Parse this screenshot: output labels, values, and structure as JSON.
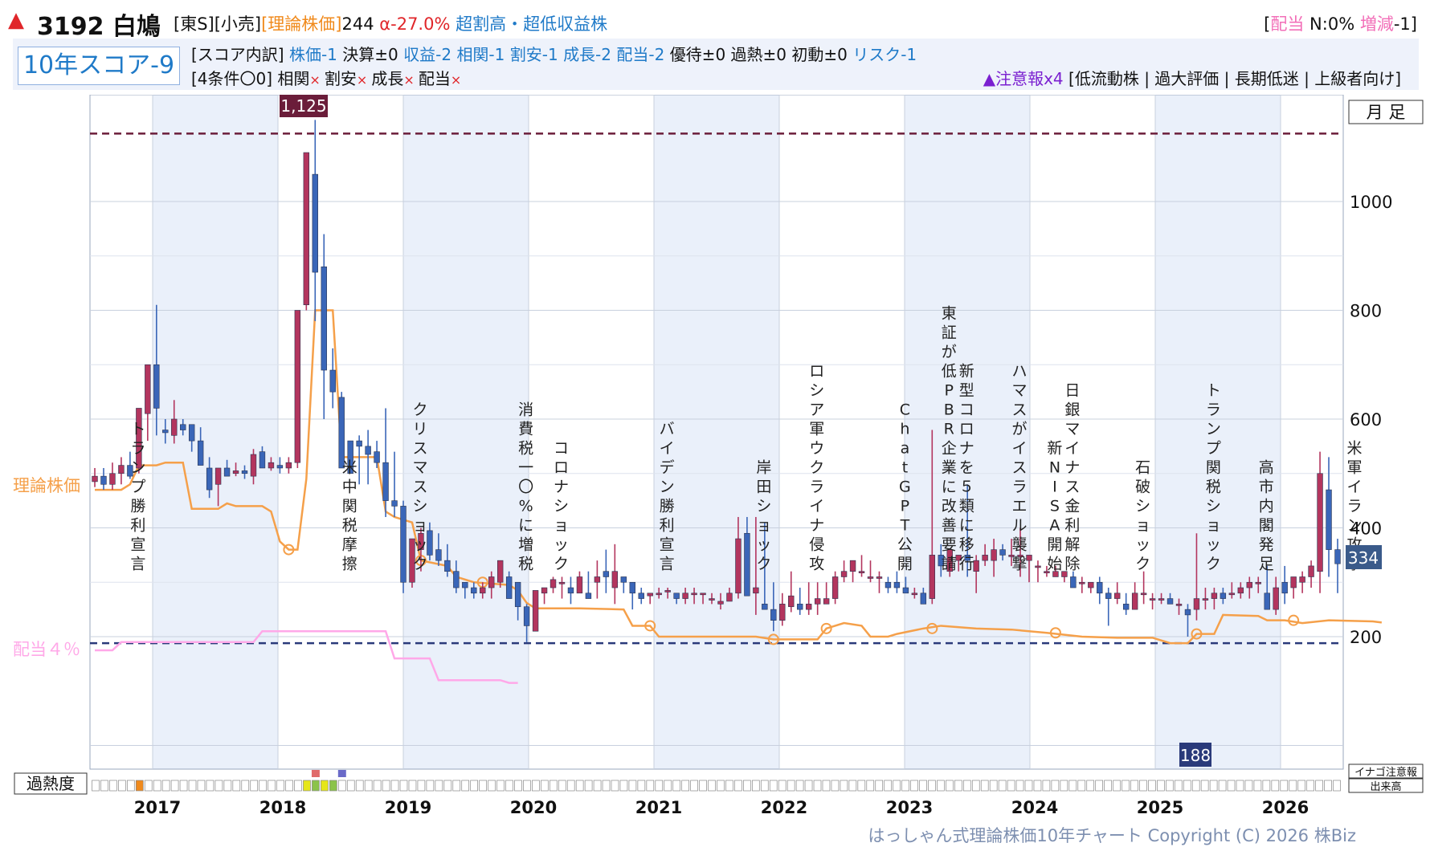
{
  "header": {
    "code": "3192",
    "name": "白鳩",
    "market": "[東S]",
    "industry": "[小売]",
    "theory_label": "[理論株価]",
    "theory_value": "244",
    "alpha": "α-27.0%",
    "tags": "超割高・超低収益株",
    "dividend_label": "配当",
    "dividend_n": "N:0%",
    "dividend_change_label": "増減",
    "dividend_change": "-1"
  },
  "score": {
    "box": "10年スコア-9",
    "breakdown_label": "[スコア内訳]",
    "items": [
      {
        "text": "株価-1",
        "color": "#1f7ac8"
      },
      {
        "text": "決算±0",
        "color": "#111111"
      },
      {
        "text": "収益-2",
        "color": "#1f7ac8"
      },
      {
        "text": "相関-1",
        "color": "#1f7ac8"
      },
      {
        "text": "割安-1",
        "color": "#1f7ac8"
      },
      {
        "text": "成長-2",
        "color": "#1f7ac8"
      },
      {
        "text": "配当-2",
        "color": "#1f7ac8"
      },
      {
        "text": "優待±0",
        "color": "#111111"
      },
      {
        "text": "過熱±0",
        "color": "#111111"
      },
      {
        "text": "初動±0",
        "color": "#111111"
      },
      {
        "text": "リスク-1",
        "color": "#1f7ac8"
      }
    ],
    "conditions_label": "[4条件〇0]",
    "conditions": [
      "相関",
      "割安",
      "成長",
      "配当"
    ],
    "cross": "×",
    "warning_label": "▲注意報x4",
    "warning_items": "[低流動株 | 過大評価 | 長期低迷 | 上級者向け]"
  },
  "chart_data": {
    "type": "candlestick",
    "period_label": "月 足",
    "y_ticks": [
      200,
      400,
      600,
      800,
      1000
    ],
    "ylim": [
      0,
      1200
    ],
    "x_labels": [
      "2017",
      "2018",
      "2019",
      "2020",
      "2021",
      "2022",
      "2023",
      "2024",
      "2025",
      "2026"
    ],
    "max_label": "1,125",
    "min_label": "188",
    "last_label": "334",
    "high_line": 1125,
    "low_line": 188,
    "theory_label": "理論株価",
    "dividend_label": "配当４％",
    "candles": [
      [
        485,
        510,
        475,
        495
      ],
      [
        495,
        510,
        470,
        480
      ],
      [
        480,
        520,
        470,
        500
      ],
      [
        500,
        530,
        480,
        515
      ],
      [
        515,
        540,
        490,
        495
      ],
      [
        510,
        620,
        500,
        620
      ],
      [
        610,
        700,
        560,
        700
      ],
      [
        700,
        810,
        570,
        620
      ],
      [
        580,
        600,
        555,
        575
      ],
      [
        570,
        635,
        555,
        600
      ],
      [
        590,
        600,
        570,
        580
      ],
      [
        590,
        590,
        540,
        560
      ],
      [
        560,
        585,
        520,
        515
      ],
      [
        510,
        530,
        455,
        470
      ],
      [
        480,
        510,
        440,
        510
      ],
      [
        510,
        525,
        495,
        495
      ],
      [
        500,
        520,
        495,
        505
      ],
      [
        505,
        515,
        490,
        500
      ],
      [
        495,
        545,
        480,
        535
      ],
      [
        540,
        550,
        510,
        510
      ],
      [
        510,
        530,
        505,
        520
      ],
      [
        515,
        530,
        500,
        510
      ],
      [
        510,
        530,
        500,
        520
      ],
      [
        520,
        800,
        510,
        800
      ],
      [
        810,
        1090,
        800,
        1090
      ],
      [
        1050,
        1150,
        780,
        870
      ],
      [
        880,
        940,
        600,
        690
      ],
      [
        690,
        730,
        620,
        650
      ],
      [
        640,
        650,
        520,
        510
      ],
      [
        560,
        560,
        520,
        500
      ],
      [
        560,
        570,
        480,
        550
      ],
      [
        550,
        580,
        480,
        535
      ],
      [
        540,
        560,
        510,
        520
      ],
      [
        520,
        620,
        420,
        450
      ],
      [
        450,
        540,
        420,
        440
      ],
      [
        440,
        450,
        280,
        300
      ],
      [
        300,
        380,
        290,
        380
      ],
      [
        360,
        400,
        320,
        390
      ],
      [
        395,
        410,
        340,
        350
      ],
      [
        360,
        390,
        330,
        340
      ],
      [
        340,
        370,
        310,
        320
      ],
      [
        320,
        340,
        280,
        290
      ],
      [
        300,
        300,
        270,
        290
      ],
      [
        290,
        300,
        270,
        280
      ],
      [
        280,
        300,
        270,
        290
      ],
      [
        290,
        320,
        270,
        310
      ],
      [
        300,
        340,
        290,
        340
      ],
      [
        310,
        320,
        270,
        270
      ],
      [
        300,
        300,
        230,
        255
      ],
      [
        255,
        260,
        190,
        220
      ],
      [
        210,
        280,
        210,
        285
      ],
      [
        280,
        290,
        260,
        290
      ],
      [
        290,
        310,
        280,
        305
      ],
      [
        300,
        310,
        270,
        300
      ],
      [
        290,
        310,
        260,
        280
      ],
      [
        280,
        320,
        280,
        310
      ],
      [
        280,
        320,
        270,
        270
      ],
      [
        300,
        340,
        270,
        310
      ],
      [
        320,
        360,
        280,
        310
      ],
      [
        290,
        370,
        260,
        320
      ],
      [
        310,
        310,
        280,
        300
      ],
      [
        300,
        300,
        250,
        280
      ],
      [
        280,
        290,
        260,
        270
      ],
      [
        275,
        280,
        260,
        280
      ],
      [
        280,
        290,
        270,
        280
      ],
      [
        285,
        290,
        270,
        285
      ],
      [
        280,
        280,
        260,
        270
      ],
      [
        270,
        290,
        260,
        280
      ],
      [
        280,
        290,
        260,
        280
      ],
      [
        280,
        280,
        260,
        280
      ],
      [
        270,
        280,
        260,
        270
      ],
      [
        260,
        280,
        250,
        265
      ],
      [
        265,
        290,
        270,
        280
      ],
      [
        280,
        420,
        270,
        380
      ],
      [
        390,
        420,
        300,
        275
      ],
      [
        280,
        420,
        240,
        290
      ],
      [
        260,
        410,
        250,
        250
      ],
      [
        250,
        300,
        210,
        230
      ],
      [
        230,
        280,
        220,
        260
      ],
      [
        255,
        320,
        245,
        275
      ],
      [
        260,
        290,
        240,
        250
      ],
      [
        250,
        300,
        240,
        260
      ],
      [
        260,
        300,
        240,
        270
      ],
      [
        260,
        300,
        260,
        270
      ],
      [
        270,
        320,
        260,
        310
      ],
      [
        310,
        340,
        300,
        320
      ],
      [
        320,
        340,
        300,
        340
      ],
      [
        320,
        350,
        310,
        320
      ],
      [
        310,
        340,
        300,
        310
      ],
      [
        310,
        320,
        280,
        310
      ],
      [
        300,
        310,
        280,
        290
      ],
      [
        300,
        320,
        280,
        290
      ],
      [
        290,
        310,
        280,
        280
      ],
      [
        280,
        290,
        270,
        280
      ],
      [
        280,
        290,
        260,
        260
      ],
      [
        270,
        580,
        260,
        350
      ],
      [
        350,
        370,
        310,
        330
      ],
      [
        320,
        360,
        310,
        360
      ],
      [
        340,
        350,
        320,
        350
      ],
      [
        350,
        480,
        310,
        340
      ],
      [
        320,
        350,
        280,
        340
      ],
      [
        340,
        370,
        330,
        350
      ],
      [
        340,
        380,
        310,
        360
      ],
      [
        360,
        370,
        340,
        350
      ],
      [
        350,
        380,
        330,
        350
      ],
      [
        350,
        400,
        310,
        350
      ],
      [
        340,
        340,
        300,
        350
      ],
      [
        330,
        340,
        300,
        330
      ],
      [
        320,
        330,
        310,
        320
      ],
      [
        310,
        330,
        310,
        320
      ],
      [
        310,
        320,
        300,
        320
      ],
      [
        310,
        320,
        290,
        290
      ],
      [
        300,
        310,
        280,
        300
      ],
      [
        290,
        300,
        280,
        300
      ],
      [
        300,
        310,
        260,
        280
      ],
      [
        280,
        290,
        220,
        270
      ],
      [
        270,
        300,
        260,
        280
      ],
      [
        260,
        280,
        240,
        250
      ],
      [
        250,
        300,
        250,
        280
      ],
      [
        280,
        320,
        260,
        280
      ],
      [
        270,
        280,
        250,
        270
      ],
      [
        270,
        280,
        260,
        270
      ],
      [
        270,
        280,
        260,
        260
      ],
      [
        260,
        270,
        240,
        260
      ],
      [
        250,
        260,
        200,
        240
      ],
      [
        250,
        390,
        230,
        270
      ],
      [
        270,
        290,
        250,
        270
      ],
      [
        270,
        290,
        250,
        280
      ],
      [
        280,
        290,
        260,
        270
      ],
      [
        280,
        300,
        270,
        280
      ],
      [
        280,
        300,
        270,
        290
      ],
      [
        290,
        310,
        270,
        300
      ],
      [
        300,
        310,
        280,
        300
      ],
      [
        280,
        330,
        250,
        250
      ],
      [
        250,
        310,
        240,
        290
      ],
      [
        300,
        330,
        260,
        280
      ],
      [
        290,
        310,
        270,
        310
      ],
      [
        300,
        320,
        280,
        310
      ],
      [
        310,
        340,
        290,
        330
      ],
      [
        320,
        540,
        280,
        500
      ],
      [
        470,
        530,
        310,
        360
      ],
      [
        360,
        380,
        280,
        334
      ]
    ],
    "theory": [
      [
        0,
        470
      ],
      [
        3,
        470
      ],
      [
        4,
        480
      ],
      [
        5,
        515
      ],
      [
        7,
        515
      ],
      [
        8,
        520
      ],
      [
        10,
        520
      ],
      [
        11,
        435
      ],
      [
        14,
        435
      ],
      [
        15,
        445
      ],
      [
        16,
        440
      ],
      [
        18,
        440
      ],
      [
        19,
        440
      ],
      [
        20,
        430
      ],
      [
        21,
        375
      ],
      [
        22,
        360
      ],
      [
        23,
        360
      ],
      [
        24,
        490
      ],
      [
        25,
        800
      ],
      [
        27,
        800
      ],
      [
        28,
        530
      ],
      [
        32,
        530
      ],
      [
        33,
        430
      ],
      [
        34,
        420
      ],
      [
        36,
        410
      ],
      [
        37,
        340
      ],
      [
        40,
        330
      ],
      [
        41,
        310
      ],
      [
        43,
        300
      ],
      [
        47,
        295
      ],
      [
        48,
        285
      ],
      [
        49,
        262
      ],
      [
        50,
        252
      ],
      [
        55,
        252
      ],
      [
        60,
        250
      ],
      [
        61,
        220
      ],
      [
        63,
        220
      ],
      [
        64,
        200
      ],
      [
        66,
        200
      ],
      [
        72,
        200
      ],
      [
        75,
        200
      ],
      [
        77,
        195
      ],
      [
        82,
        195
      ],
      [
        83,
        215
      ],
      [
        85,
        225
      ],
      [
        87,
        220
      ],
      [
        88,
        200
      ],
      [
        90,
        200
      ],
      [
        91,
        205
      ],
      [
        94,
        215
      ],
      [
        96,
        220
      ],
      [
        100,
        215
      ],
      [
        104,
        213
      ],
      [
        108,
        207
      ],
      [
        112,
        200
      ],
      [
        116,
        198
      ],
      [
        120,
        198
      ],
      [
        122,
        188
      ],
      [
        124,
        188
      ],
      [
        125,
        205
      ],
      [
        127,
        205
      ],
      [
        128,
        240
      ],
      [
        132,
        238
      ],
      [
        133,
        230
      ],
      [
        135,
        230
      ],
      [
        137,
        225
      ],
      [
        140,
        230
      ],
      [
        145,
        228
      ],
      [
        146,
        226
      ]
    ],
    "theory_markers": [
      22,
      37,
      44,
      63,
      77,
      83,
      95,
      109,
      125,
      136
    ],
    "dividend": [
      [
        0,
        175
      ],
      [
        2,
        175
      ],
      [
        3,
        190
      ],
      [
        10,
        190
      ],
      [
        11,
        190
      ],
      [
        12,
        190
      ],
      [
        14,
        190
      ],
      [
        18,
        190
      ],
      [
        19,
        210
      ],
      [
        21,
        210
      ],
      [
        23,
        210
      ],
      [
        24,
        210
      ],
      [
        25,
        210
      ],
      [
        27,
        210
      ],
      [
        28,
        210
      ],
      [
        30,
        210
      ],
      [
        31,
        210
      ],
      [
        32,
        210
      ],
      [
        33,
        210
      ],
      [
        34,
        160
      ],
      [
        36,
        160
      ],
      [
        38,
        160
      ],
      [
        39,
        120
      ],
      [
        46,
        120
      ],
      [
        47,
        115
      ],
      [
        48,
        115
      ]
    ],
    "events": [
      {
        "x": 4,
        "text": "トランプ勝利宣言"
      },
      {
        "x": 28,
        "text": "米中関税摩擦"
      },
      {
        "x": 36,
        "text": "クリスマスショック"
      },
      {
        "x": 48,
        "text": "消費税一〇%に増税"
      },
      {
        "x": 52,
        "text": "コロナショック"
      },
      {
        "x": 64,
        "text": "バイデン勝利宣言"
      },
      {
        "x": 75,
        "text": "岸田ショック"
      },
      {
        "x": 81,
        "text": "ロシア軍ウクライナ侵攻"
      },
      {
        "x": 91,
        "text": "ChatGPT公開"
      },
      {
        "x": 96,
        "text": "東証が低PBR企業に改善要請"
      },
      {
        "x": 98,
        "text": "新型コロナを５類に移行"
      },
      {
        "x": 104,
        "text": "ハマスがイスラエル襲撃"
      },
      {
        "x": 108,
        "text": "新NISA開始"
      },
      {
        "x": 110,
        "text": "日銀マイナス金利解除"
      },
      {
        "x": 118,
        "text": "石破ショック"
      },
      {
        "x": 126,
        "text": "トランプ関税ショック"
      },
      {
        "x": 132,
        "text": "高市内閣発足"
      },
      {
        "x": 142,
        "text": "米軍イラン攻撃"
      }
    ],
    "heat_label": "過熱度",
    "heat_cells": [
      {
        "i": 5,
        "color": "#f08a1c"
      },
      {
        "i": 24,
        "color": "#e6e61a"
      },
      {
        "i": 25,
        "color": "#8bc34a"
      },
      {
        "i": 26,
        "color": "#e6e61a"
      },
      {
        "i": 27,
        "color": "#8bc34a"
      }
    ],
    "heat_marks": [
      {
        "i": 25,
        "color": "#e06a6a"
      },
      {
        "i": 28,
        "color": "#6a6ac8"
      },
      {
        "i": 144,
        "color": "#e06a6a"
      }
    ],
    "side_labels": [
      "イナゴ注意報",
      "出来高"
    ],
    "colors": {
      "up": "#b3355e",
      "down": "#3a66b8",
      "theory": "#f5a04a",
      "dividend": "#ffa8e8",
      "highline": "#6b1d3a",
      "lowline": "#2a3a7a"
    }
  },
  "footer": {
    "copyright": "はっしゃん式理論株価10年チャート Copyright (C) 2026 株Biz"
  }
}
